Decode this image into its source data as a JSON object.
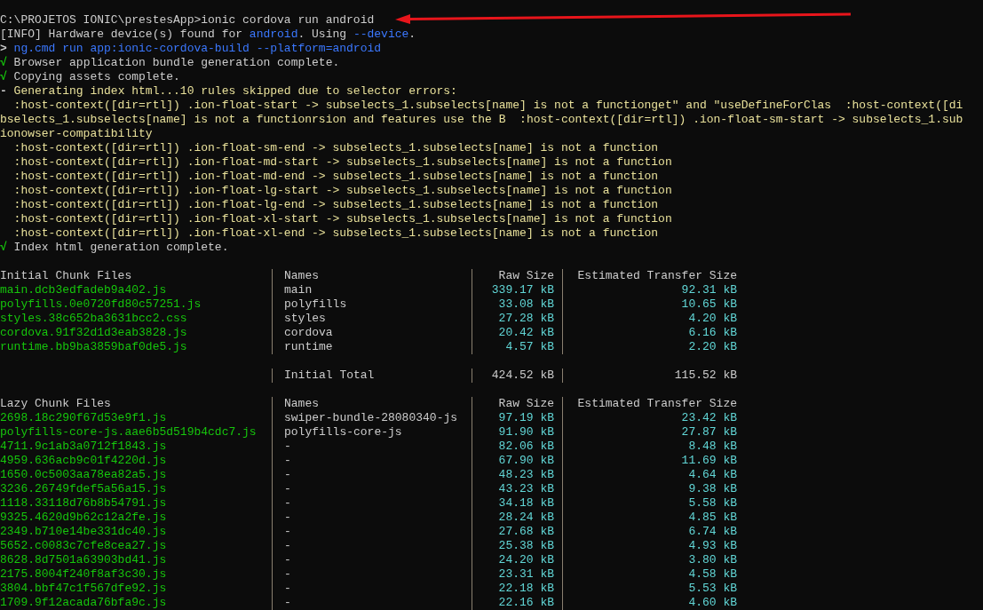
{
  "console_lines": [
    {
      "segments": [
        {
          "text": "C:\\PROJETOS IONIC\\prestesApp>ionic cordova run android",
          "color": "#cccccc"
        }
      ]
    },
    {
      "segments": [
        {
          "text": "[INFO] Hardware device(s) found for ",
          "color": "#cccccc"
        },
        {
          "text": "android",
          "color": "#3b78ff"
        },
        {
          "text": ". Using ",
          "color": "#cccccc"
        },
        {
          "text": "--device",
          "color": "#3b78ff"
        },
        {
          "text": "."
        }
      ]
    },
    {
      "segments": [
        {
          "text": "> ",
          "color": "#cccccc"
        },
        {
          "text": "ng.cmd run app:ionic-cordova-build --platform=android",
          "color": "#3b78ff"
        }
      ]
    },
    {
      "segments": [
        {
          "text": "√",
          "color": "#16c60c"
        },
        {
          "text": " Browser application bundle generation complete.",
          "color": "#cccccc"
        }
      ]
    },
    {
      "segments": [
        {
          "text": "√",
          "color": "#16c60c"
        },
        {
          "text": " Copying assets complete.",
          "color": "#cccccc"
        }
      ]
    },
    {
      "segments": [
        {
          "text": "- ",
          "color": "#cccccc"
        },
        {
          "text": "Generating index html...10 rules skipped due to selector errors:",
          "color": "#e8e09a"
        }
      ]
    },
    {
      "segments": [
        {
          "text": "  :host-context([dir=rtl]) .ion-float-start -> subselects_1.subselects[name] is not a functionget\" and \"useDefineForClas  :host-context([di",
          "color": "#e8e09a"
        }
      ]
    },
    {
      "segments": [
        {
          "text": "bselects_1.subselects[name] is not a functionrsion and features use the B  :host-context([dir=rtl]) .ion-float-sm-start -> subselects_1.sub",
          "color": "#e8e09a"
        }
      ]
    },
    {
      "segments": [
        {
          "text": "ionowser-compatibility",
          "color": "#e8e09a"
        }
      ]
    },
    {
      "segments": [
        {
          "text": "  :host-context([dir=rtl]) .ion-float-sm-end -> subselects_1.subselects[name] is not a function",
          "color": "#e8e09a"
        }
      ]
    },
    {
      "segments": [
        {
          "text": "  :host-context([dir=rtl]) .ion-float-md-start -> subselects_1.subselects[name] is not a function",
          "color": "#e8e09a"
        }
      ]
    },
    {
      "segments": [
        {
          "text": "  :host-context([dir=rtl]) .ion-float-md-end -> subselects_1.subselects[name] is not a function",
          "color": "#e8e09a"
        }
      ]
    },
    {
      "segments": [
        {
          "text": "  :host-context([dir=rtl]) .ion-float-lg-start -> subselects_1.subselects[name] is not a function",
          "color": "#e8e09a"
        }
      ]
    },
    {
      "segments": [
        {
          "text": "  :host-context([dir=rtl]) .ion-float-lg-end -> subselects_1.subselects[name] is not a function",
          "color": "#e8e09a"
        }
      ]
    },
    {
      "segments": [
        {
          "text": "  :host-context([dir=rtl]) .ion-float-xl-start -> subselects_1.subselects[name] is not a function",
          "color": "#e8e09a"
        }
      ]
    },
    {
      "segments": [
        {
          "text": "  :host-context([dir=rtl]) .ion-float-xl-end -> subselects_1.subselects[name] is not a function",
          "color": "#e8e09a"
        }
      ]
    },
    {
      "segments": [
        {
          "text": "√",
          "color": "#16c60c"
        },
        {
          "text": " Index html generation complete.",
          "color": "#cccccc"
        }
      ]
    }
  ],
  "initial_chunks": {
    "columns": [
      "Initial Chunk Files",
      "Names",
      "Raw Size",
      "Estimated Transfer Size"
    ],
    "rows": [
      {
        "file": "main.dcb3edfadeb9a402.js",
        "name": "main",
        "raw_size": "339.17 kB",
        "transfer_size": "92.31 kB"
      },
      {
        "file": "polyfills.0e0720fd80c57251.js",
        "name": "polyfills",
        "raw_size": "33.08 kB",
        "transfer_size": "10.65 kB"
      },
      {
        "file": "styles.38c652ba3631bcc2.css",
        "name": "styles",
        "raw_size": "27.28 kB",
        "transfer_size": "4.20 kB"
      },
      {
        "file": "cordova.91f32d1d3eab3828.js",
        "name": "cordova",
        "raw_size": "20.42 kB",
        "transfer_size": "6.16 kB"
      },
      {
        "file": "runtime.bb9ba3859baf0de5.js",
        "name": "runtime",
        "raw_size": "4.57 kB",
        "transfer_size": "2.20 kB"
      }
    ],
    "total": {
      "label": "Initial Total",
      "raw_size": "424.52 kB",
      "transfer_size": "115.52 kB"
    }
  },
  "lazy_chunks": {
    "columns": [
      "Lazy Chunk Files",
      "Names",
      "Raw Size",
      "Estimated Transfer Size"
    ],
    "rows": [
      {
        "file": "2698.18c290f67d53e9f1.js",
        "name": "swiper-bundle-28080340-js",
        "raw_size": "97.19 kB",
        "transfer_size": "23.42 kB"
      },
      {
        "file": "polyfills-core-js.aae6b5d519b4cdc7.js",
        "name": "polyfills-core-js",
        "raw_size": "91.90 kB",
        "transfer_size": "27.87 kB"
      },
      {
        "file": "4711.9c1ab3a0712f1843.js",
        "name": "-",
        "raw_size": "82.06 kB",
        "transfer_size": "8.48 kB"
      },
      {
        "file": "4959.636acb9c01f4220d.js",
        "name": "-",
        "raw_size": "67.90 kB",
        "transfer_size": "11.69 kB"
      },
      {
        "file": "1650.0c5003aa78ea82a5.js",
        "name": "-",
        "raw_size": "48.23 kB",
        "transfer_size": "4.64 kB"
      },
      {
        "file": "3236.26749fdef5a56a15.js",
        "name": "-",
        "raw_size": "43.23 kB",
        "transfer_size": "9.38 kB"
      },
      {
        "file": "1118.33118d76b8b54791.js",
        "name": "-",
        "raw_size": "34.18 kB",
        "transfer_size": "5.58 kB"
      },
      {
        "file": "9325.4620d9b62c12a2fe.js",
        "name": "-",
        "raw_size": "28.24 kB",
        "transfer_size": "4.85 kB"
      },
      {
        "file": "2349.b710e14be331dc40.js",
        "name": "-",
        "raw_size": "27.68 kB",
        "transfer_size": "6.74 kB"
      },
      {
        "file": "5652.c0083c7cfe8cea27.js",
        "name": "-",
        "raw_size": "25.38 kB",
        "transfer_size": "4.93 kB"
      },
      {
        "file": "8628.8d7501a63903bd41.js",
        "name": "-",
        "raw_size": "24.20 kB",
        "transfer_size": "3.80 kB"
      },
      {
        "file": "2175.8004f240f8af3c30.js",
        "name": "-",
        "raw_size": "23.31 kB",
        "transfer_size": "4.58 kB"
      },
      {
        "file": "3804.bbf47c1f567dfe92.js",
        "name": "-",
        "raw_size": "22.18 kB",
        "transfer_size": "5.53 kB"
      },
      {
        "file": "1709.9f12acada76bfa9c.js",
        "name": "-",
        "raw_size": "22.16 kB",
        "transfer_size": "4.60 kB"
      }
    ]
  }
}
